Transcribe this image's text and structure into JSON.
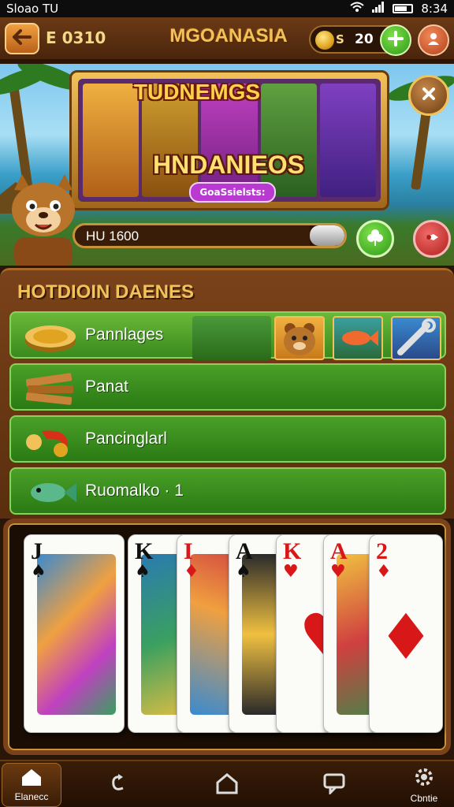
{
  "status_bar": {
    "left_text": "Sloao TU",
    "time": "8:34"
  },
  "top_bar": {
    "code": "E 0310",
    "title": "MGOANASIA",
    "coin_prefix": "S",
    "coin_value": "20"
  },
  "banner": {
    "slot_title": "TUDNEMGS",
    "slot_logo": "HNDANIEOS",
    "slot_badge": "GoaSsielsts:",
    "progress_label": "HU 1600",
    "progress_fraction": 0.87
  },
  "hot_games": {
    "title": "HOTDIOIN DAENES",
    "rows": [
      {
        "label": "Pannlages",
        "icon": "gold-coin-icon"
      },
      {
        "label": "Panat",
        "icon": "wood-plank-icon"
      },
      {
        "label": "Pancinglarl",
        "icon": "chili-coin-icon"
      },
      {
        "label": "Ruomalko · 1",
        "icon": "fish-icon"
      }
    ]
  },
  "cards": [
    {
      "rank": "J",
      "suit": "♠",
      "color": "black"
    },
    {
      "rank": "K",
      "suit": "♠",
      "color": "black"
    },
    {
      "rank": "I",
      "suit": "♦",
      "color": "red"
    },
    {
      "rank": "A",
      "suit": "♠",
      "color": "black"
    },
    {
      "rank": "K",
      "suit": "♥",
      "color": "red"
    },
    {
      "rank": "A",
      "suit": "♥",
      "color": "red"
    },
    {
      "rank": "2",
      "suit": "♦",
      "color": "red"
    }
  ],
  "bottom_nav": [
    {
      "label": "Elanecc",
      "icon": "home-icon"
    },
    {
      "label": "",
      "icon": "refresh-icon"
    },
    {
      "label": "",
      "icon": "house-outline-icon"
    },
    {
      "label": "",
      "icon": "chat-icon"
    },
    {
      "label": "Cbntie",
      "icon": "settings-icon"
    }
  ],
  "colors": {
    "accent_gold": "#f2c25a",
    "row_green": "#2a7a14",
    "panel_brown": "#5a2e0e"
  }
}
